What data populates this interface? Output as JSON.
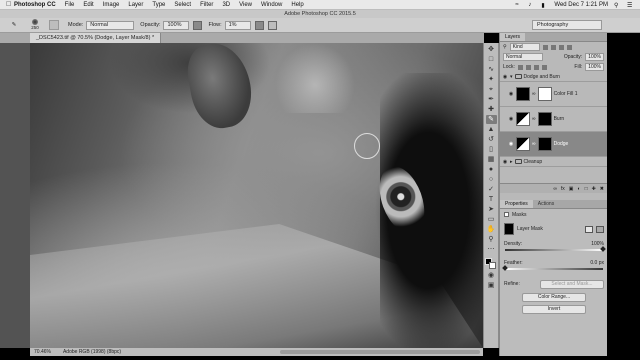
{
  "menubar": {
    "app": "Photoshop CC",
    "items": [
      "File",
      "Edit",
      "Image",
      "Layer",
      "Type",
      "Select",
      "Filter",
      "3D",
      "View",
      "Window",
      "Help"
    ],
    "clock": "Wed Dec 7  1:21 PM"
  },
  "window_title": "Adobe Photoshop CC 2015.5",
  "options": {
    "brush_size": "250",
    "mode_label": "Mode:",
    "mode_value": "Normal",
    "opacity_label": "Opacity:",
    "opacity_value": "100%",
    "flow_label": "Flow:",
    "flow_value": "1%",
    "workspace": "Photography"
  },
  "document_tab": "_DSC5423.tif @ 70.5% (Dodge, Layer Mask/8) *",
  "status": {
    "zoom": "70.46%",
    "profile": "Adobe RGB (1998) (8bpc)"
  },
  "layers_panel": {
    "tabs": [
      "Layers"
    ],
    "kind": "Kind",
    "blend_mode": "Normal",
    "opacity_label": "Opacity:",
    "opacity_value": "100%",
    "lock_label": "Lock:",
    "fill_label": "Fill:",
    "fill_value": "100%",
    "group_name": "Dodge and Burn",
    "layers": [
      {
        "name": "Color Fill 1"
      },
      {
        "name": "Burn"
      },
      {
        "name": "Dodge"
      }
    ],
    "cleanup_group": "Cleanup"
  },
  "properties_panel": {
    "tabs": [
      "Properties",
      "Actions"
    ],
    "section": "Masks",
    "mask_type": "Layer Mask",
    "density_label": "Density:",
    "density_value": "100%",
    "density_level": 1.0,
    "feather_label": "Feather:",
    "feather_value": "0.0 px",
    "feather_level": 0.0,
    "refine_label": "Refine:",
    "select_and_mask": "Select and Mask...",
    "color_range": "Color Range...",
    "invert": "Invert"
  }
}
